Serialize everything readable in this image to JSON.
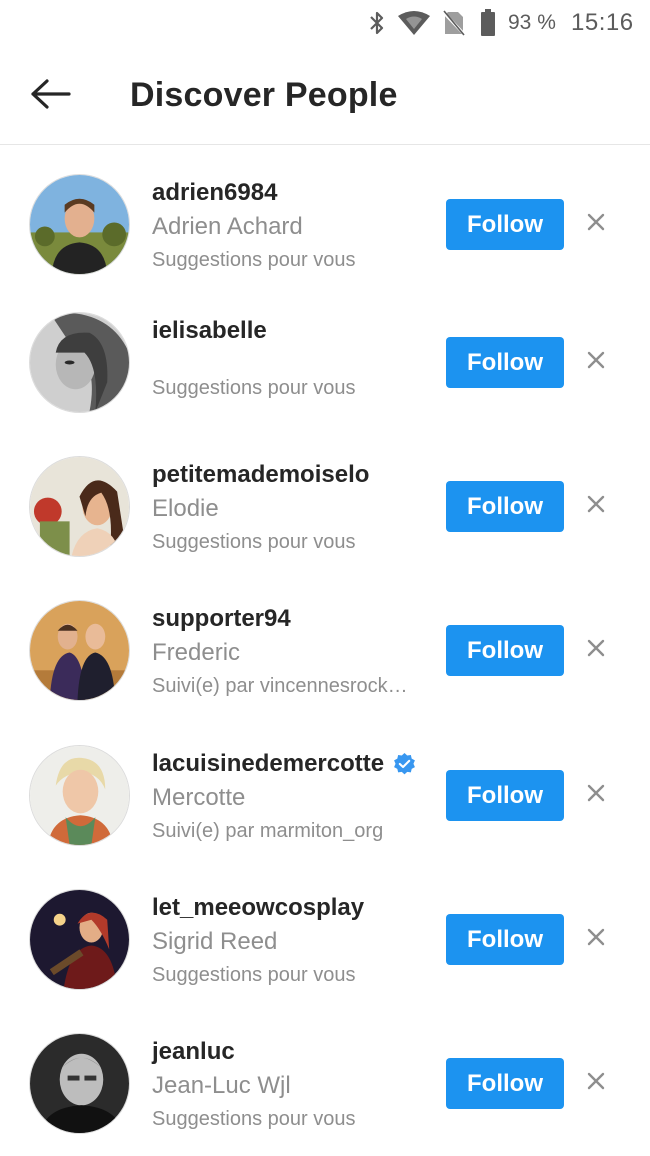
{
  "status_bar": {
    "battery_percent": "93 %",
    "time": "15:16",
    "icons": [
      "bluetooth-icon",
      "wifi-icon",
      "no-sim-icon",
      "battery-icon"
    ]
  },
  "header": {
    "title": "Discover People",
    "back_icon": "arrow-left-icon"
  },
  "follow_label": "Follow",
  "people": [
    {
      "username": "adrien6984",
      "full_name": "Adrien Achard",
      "subtitle": "Suggestions pour vous",
      "verified": false
    },
    {
      "username": "ielisabelle",
      "full_name": "",
      "subtitle": "Suggestions pour vous",
      "verified": false
    },
    {
      "username": "petitemademoiselo",
      "full_name": "Elodie",
      "subtitle": "Suggestions pour vous",
      "verified": false
    },
    {
      "username": "supporter94",
      "full_name": "Frederic",
      "subtitle": "Suivi(e) par vincennesrock…",
      "verified": false
    },
    {
      "username": "lacuisinedemercotte",
      "full_name": "Mercotte",
      "subtitle": "Suivi(e) par marmiton_org",
      "verified": true
    },
    {
      "username": "let_meeowcosplay",
      "full_name": "Sigrid Reed",
      "subtitle": "Suggestions pour vous",
      "verified": false
    },
    {
      "username": "jeanluc",
      "full_name": "Jean-Luc Wjl",
      "subtitle": "Suggestions pour vous",
      "verified": false
    }
  ],
  "colors": {
    "follow_button": "#1c93f0",
    "verified_badge": "#3897f0",
    "secondary_text": "#8e8e8e"
  }
}
